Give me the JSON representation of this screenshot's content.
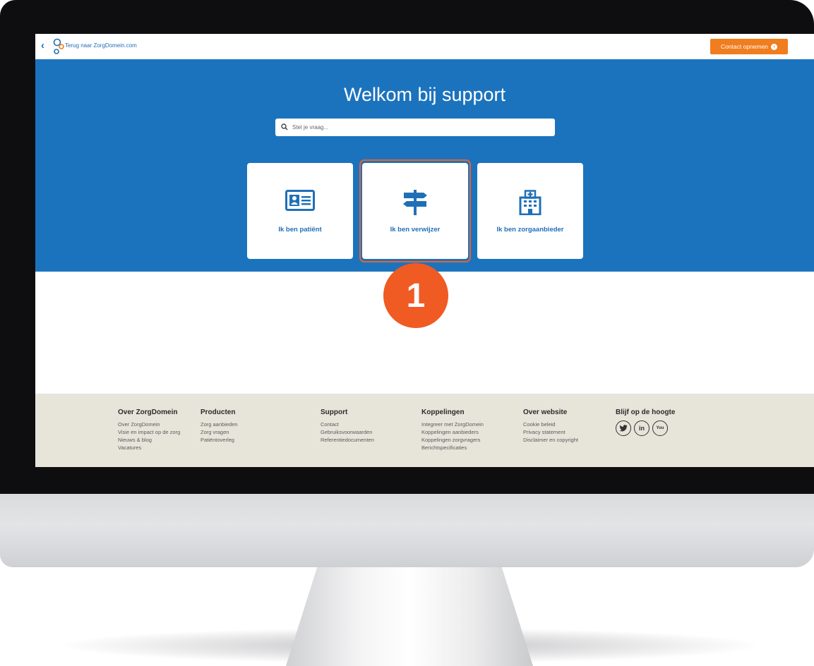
{
  "topbar": {
    "back_label": "Terug naar ZorgDomein.com",
    "contact_label": "Contact opnemen",
    "logo_icon": "zorgdomein-logo-icon"
  },
  "hero": {
    "title": "Welkom bij support",
    "search_placeholder": "Stel je vraag...",
    "cards": [
      {
        "label": "Ik ben patiënt",
        "icon": "id-card-icon"
      },
      {
        "label": "Ik ben verwijzer",
        "icon": "signpost-icon"
      },
      {
        "label": "Ik ben zorgaanbieder",
        "icon": "hospital-icon"
      }
    ],
    "step_badge": "1"
  },
  "footer": {
    "columns": [
      {
        "title": "Over ZorgDomein",
        "links": [
          "Over ZorgDomein",
          "Visie en impact op de zorg",
          "Nieuws & blog",
          "Vacatures"
        ]
      },
      {
        "title": "Producten",
        "links": [
          "Zorg aanbieden",
          "Zorg vragen",
          "Patiëntoverleg"
        ]
      },
      {
        "title": "Support",
        "links": [
          "Contact",
          "Gebruiksvoorwaarden",
          "Referentiedocumenten"
        ]
      },
      {
        "title": "Koppelingen",
        "links": [
          "Integreer met ZorgDomein",
          "Koppelingen aanbieders",
          "Koppelingen zorgvragers",
          "Berichtspecificaties"
        ]
      },
      {
        "title": "Over website",
        "links": [
          "Cookie beleid",
          "Privacy statement",
          "Disclaimer en copyright"
        ]
      },
      {
        "title": "Blijf op de hoogte",
        "links": []
      }
    ],
    "social": [
      {
        "name": "twitter-icon",
        "glyph": "🐦"
      },
      {
        "name": "linkedin-icon",
        "glyph": "in"
      },
      {
        "name": "youtube-icon",
        "glyph": "You"
      }
    ]
  },
  "colors": {
    "brand_blue": "#1c73bd",
    "accent_orange": "#f07d1e",
    "highlight_orange": "#e8622a",
    "footer_bg": "#e7e4da"
  }
}
